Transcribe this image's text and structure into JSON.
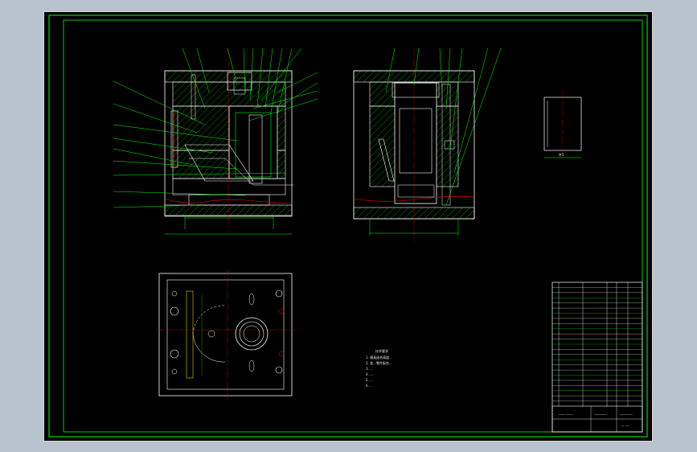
{
  "app": {
    "background_color": "#b8c3ce",
    "canvas_color": "#000000"
  },
  "colors": {
    "border": "#00ff00",
    "outline": "#ffffff",
    "center_line": "#ff0000",
    "hatch": "#00ff00",
    "annotation": "#00ff00"
  },
  "technical_requirements": {
    "heading": "技术要求",
    "lines": [
      "1. 模具闭合高度...",
      "2. 各...零件配合...",
      "3. ...",
      "4. ...",
      "5. ...",
      "6. ..."
    ]
  },
  "side_detail": {
    "label": "件5"
  },
  "title_block": {
    "rows": 24
  }
}
